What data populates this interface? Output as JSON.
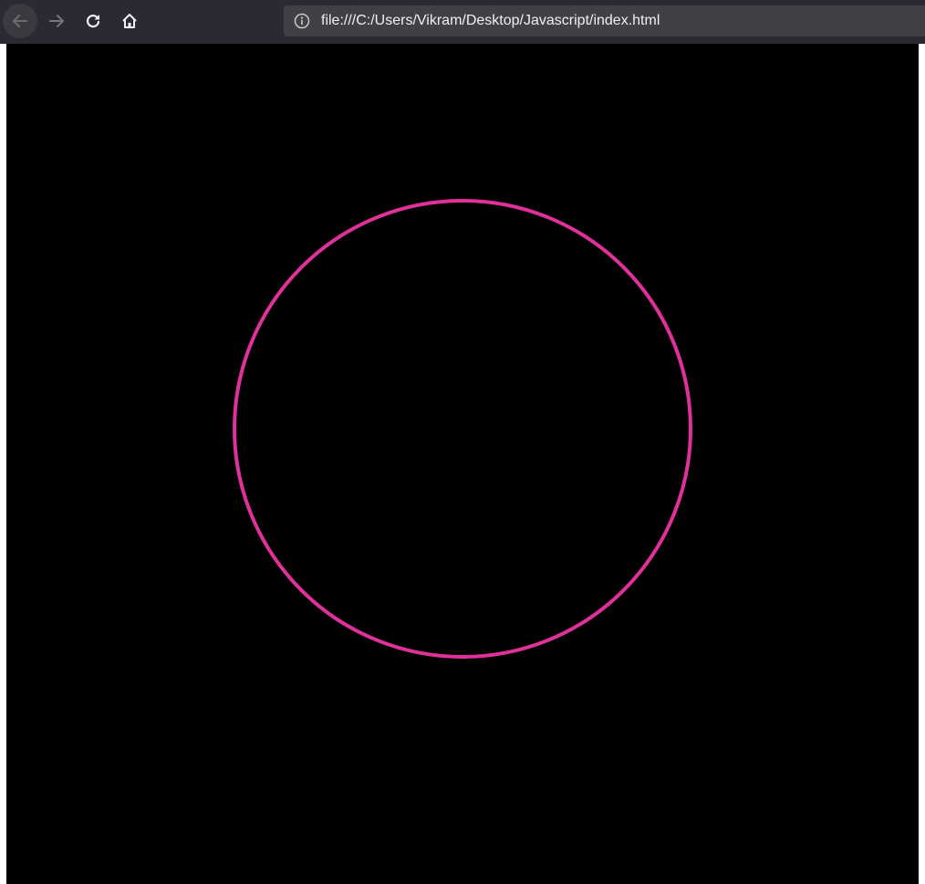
{
  "browser": {
    "url": "file:///C:/Users/Vikram/Desktop/Javascript/index.html",
    "icons": {
      "back": "back-arrow-icon",
      "forward": "forward-arrow-icon",
      "reload": "reload-icon",
      "home": "home-icon",
      "info": "info-icon"
    }
  },
  "page": {
    "background_color": "#000000",
    "shape": "circle-outline",
    "stroke_color": "#e0309a"
  }
}
